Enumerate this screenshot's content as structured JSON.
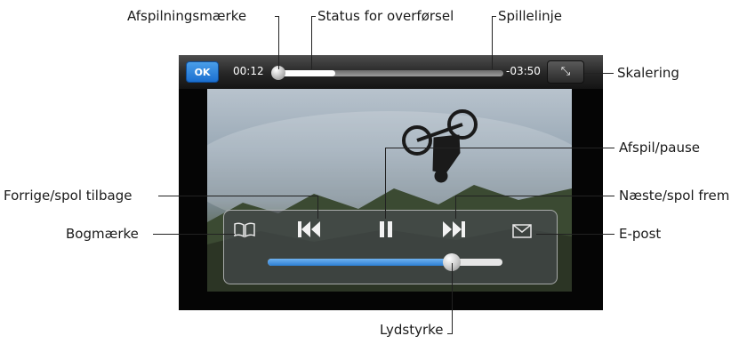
{
  "callouts": {
    "playhead": "Afspilningsmærke",
    "download_status": "Status for overførsel",
    "scrubber": "Spillelinje",
    "scale": "Skalering",
    "play_pause": "Afspil/pause",
    "previous": "Forrige/spol tilbage",
    "next": "Næste/spol frem",
    "bookmark": "Bogmærke",
    "email": "E-post",
    "volume": "Lydstyrke"
  },
  "player": {
    "ok_label": "OK",
    "elapsed": "00:12",
    "remaining": "-03:50",
    "playhead_fraction": 0.03,
    "download_fraction": 0.25,
    "volume_fraction": 0.78
  },
  "icons": {
    "scale": "scale-icon",
    "bookmark": "bookmark-icon",
    "previous": "previous-icon",
    "play_pause": "pause-icon",
    "next": "next-icon",
    "email": "envelope-icon"
  },
  "colors": {
    "ok_button": "#1b6fd0",
    "volume_fill": "#2d7fd3"
  }
}
